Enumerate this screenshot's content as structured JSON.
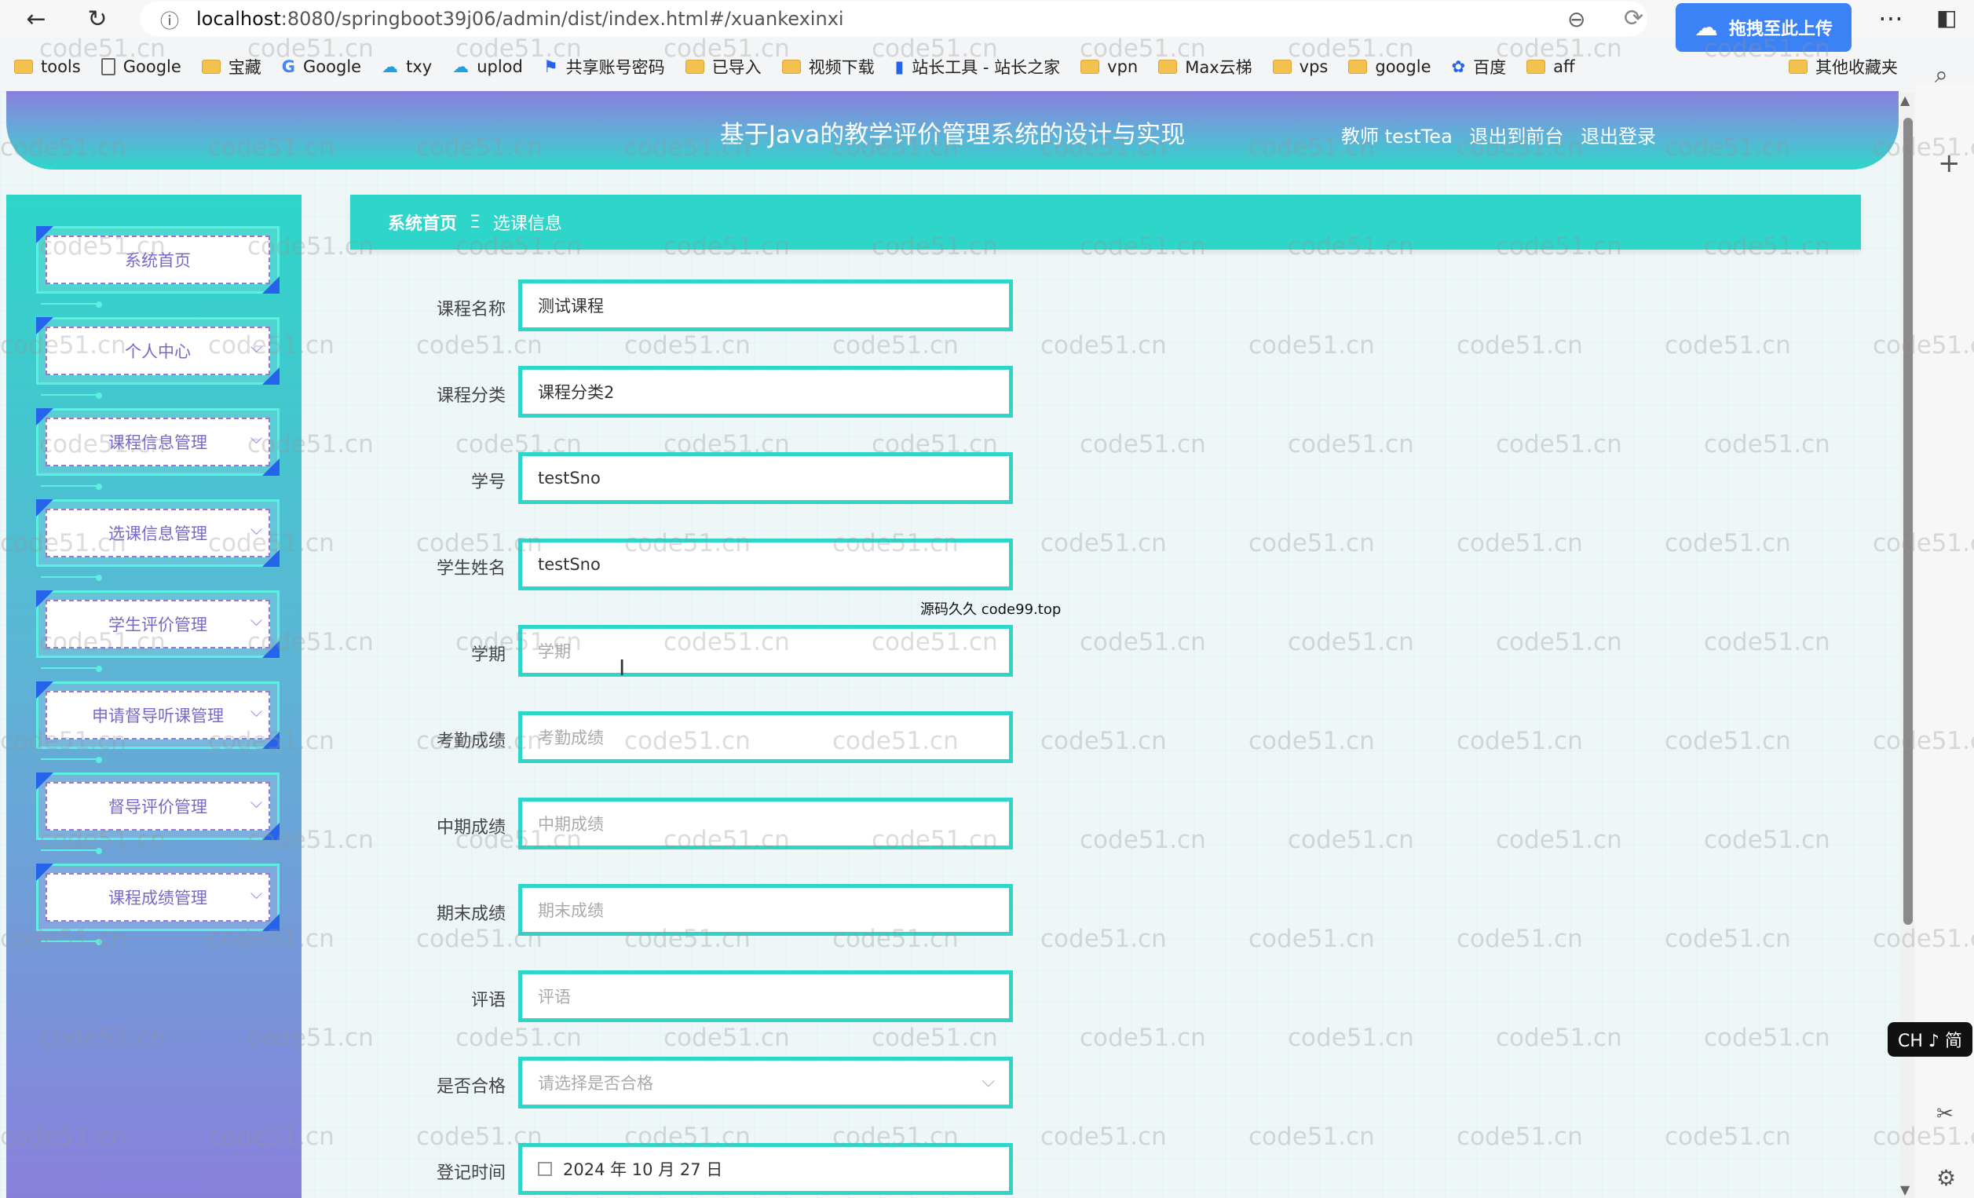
{
  "browser": {
    "url_host": "localhost",
    "url_rest": ":8080/springboot39j06/admin/dist/index.html#/xuankexinxi",
    "upload_label": "拖拽至此上传",
    "ime_label": "CH ♪ 简",
    "bookmarks": [
      "tools",
      "Google",
      "宝藏",
      "Google",
      "txy",
      "uplod",
      "共享账号密码",
      "已导入",
      "视频下载",
      "站长工具 - 站长之家",
      "vpn",
      "Max云梯",
      "vps",
      "google",
      "百度",
      "aff"
    ],
    "other_bookmarks": "其他收藏夹"
  },
  "header": {
    "title": "基于Java的教学评价管理系统的设计与实现",
    "user": "教师 testTea",
    "front_link": "退出到前台",
    "logout_link": "退出登录"
  },
  "sidebar": {
    "items": [
      {
        "label": "系统首页"
      },
      {
        "label": "个人中心"
      },
      {
        "label": "课程信息管理"
      },
      {
        "label": "选课信息管理"
      },
      {
        "label": "学生评价管理"
      },
      {
        "label": "申请督导听课管理"
      },
      {
        "label": "督导评价管理"
      },
      {
        "label": "课程成绩管理"
      }
    ]
  },
  "breadcrumb": {
    "home": "系统首页",
    "separator": "Ξ",
    "current": "选课信息"
  },
  "form": {
    "course_name": {
      "label": "课程名称",
      "value": "测试课程"
    },
    "course_category": {
      "label": "课程分类",
      "value": "课程分类2"
    },
    "student_no": {
      "label": "学号",
      "value": "testSno"
    },
    "student_name": {
      "label": "学生姓名",
      "value": "testSno"
    },
    "semester": {
      "label": "学期",
      "placeholder": "学期"
    },
    "attendance": {
      "label": "考勤成绩",
      "placeholder": "考勤成绩"
    },
    "midterm": {
      "label": "中期成绩",
      "placeholder": "中期成绩"
    },
    "final": {
      "label": "期末成绩",
      "placeholder": "期末成绩"
    },
    "comment": {
      "label": "评语",
      "placeholder": "评语"
    },
    "passed": {
      "label": "是否合格",
      "placeholder": "请选择是否合格"
    },
    "register_time": {
      "label": "登记时间",
      "value": "2024 年 10 月 27 日"
    }
  },
  "overlay_text": "源码久久 code99.top",
  "watermark": "code51.cn"
}
